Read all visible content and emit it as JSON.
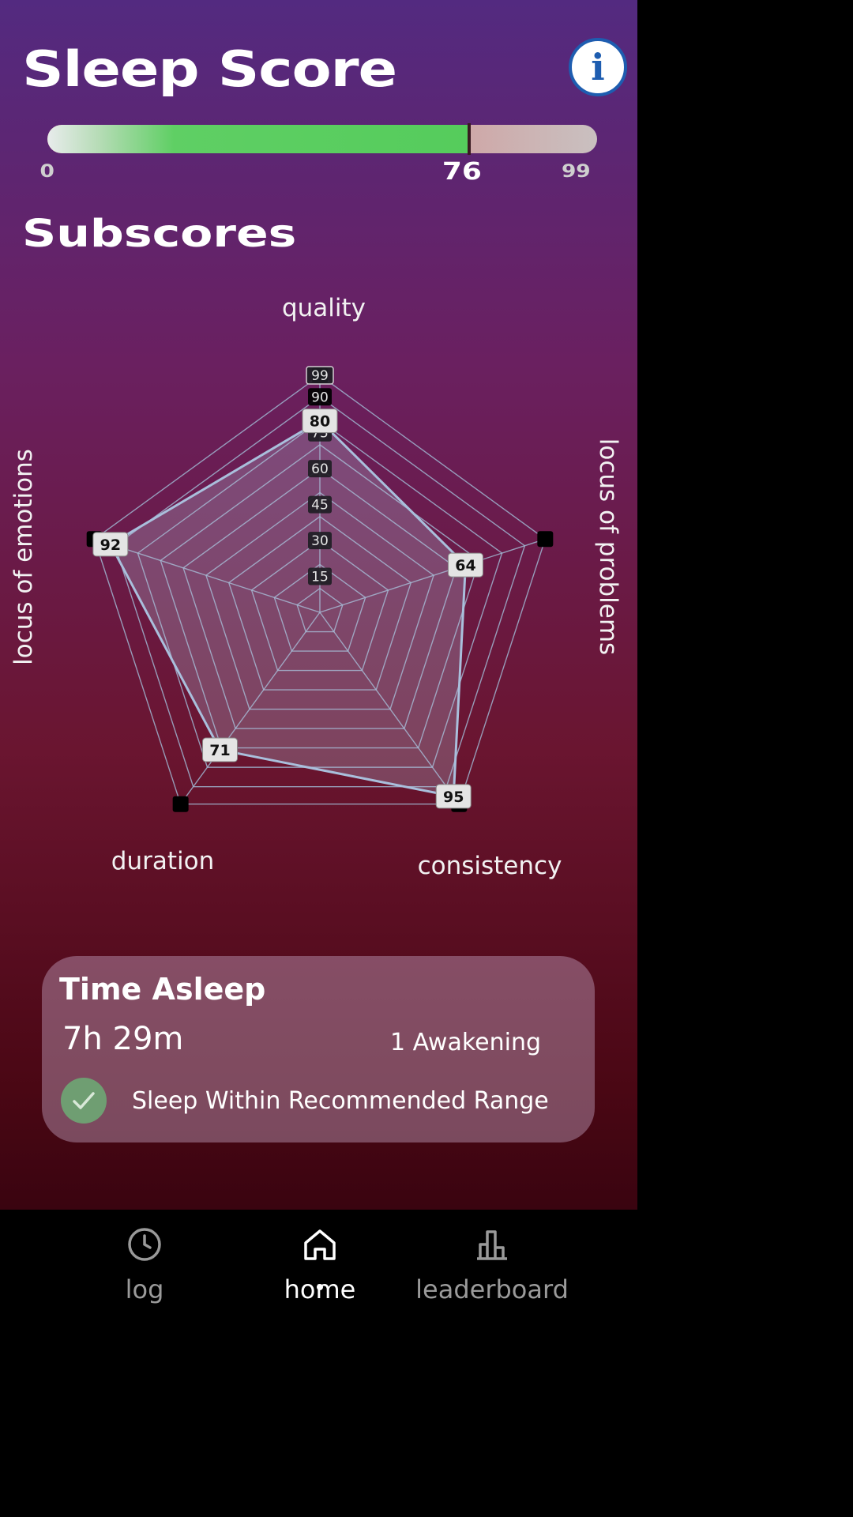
{
  "header": {
    "title": "Sleep Score",
    "info_icon": "info-icon",
    "info_glyph": "i"
  },
  "score_bar": {
    "min_label": "0",
    "value_label": "76",
    "max_label": "99",
    "value": 76,
    "max": 99,
    "fill_color": "#55cc5c",
    "remainder_color": "#e05a5a"
  },
  "subscores": {
    "title": "Subscores"
  },
  "chart_data": {
    "type": "radar",
    "axes": [
      "quality",
      "locus of problems",
      "consistency",
      "duration",
      "locus of emotions"
    ],
    "values": [
      80,
      64,
      95,
      71,
      92
    ],
    "rmax": 99,
    "ring_values": [
      15,
      30,
      45,
      60,
      75,
      90,
      99
    ],
    "ring_labels": [
      "15",
      "30",
      "45",
      "60",
      "75",
      "90",
      "99"
    ],
    "grid": true
  },
  "time_asleep": {
    "title": "Time Asleep",
    "duration": "7h 29m",
    "awakenings": "1 Awakening",
    "status": "Sleep Within Recommended Range",
    "status_icon": "check-icon"
  },
  "nav": {
    "items": [
      {
        "label": "log",
        "icon": "clock-icon"
      },
      {
        "label": "home",
        "icon": "home-icon"
      },
      {
        "label": "leaderboard",
        "icon": "bar-chart-icon"
      }
    ],
    "active": "home"
  }
}
